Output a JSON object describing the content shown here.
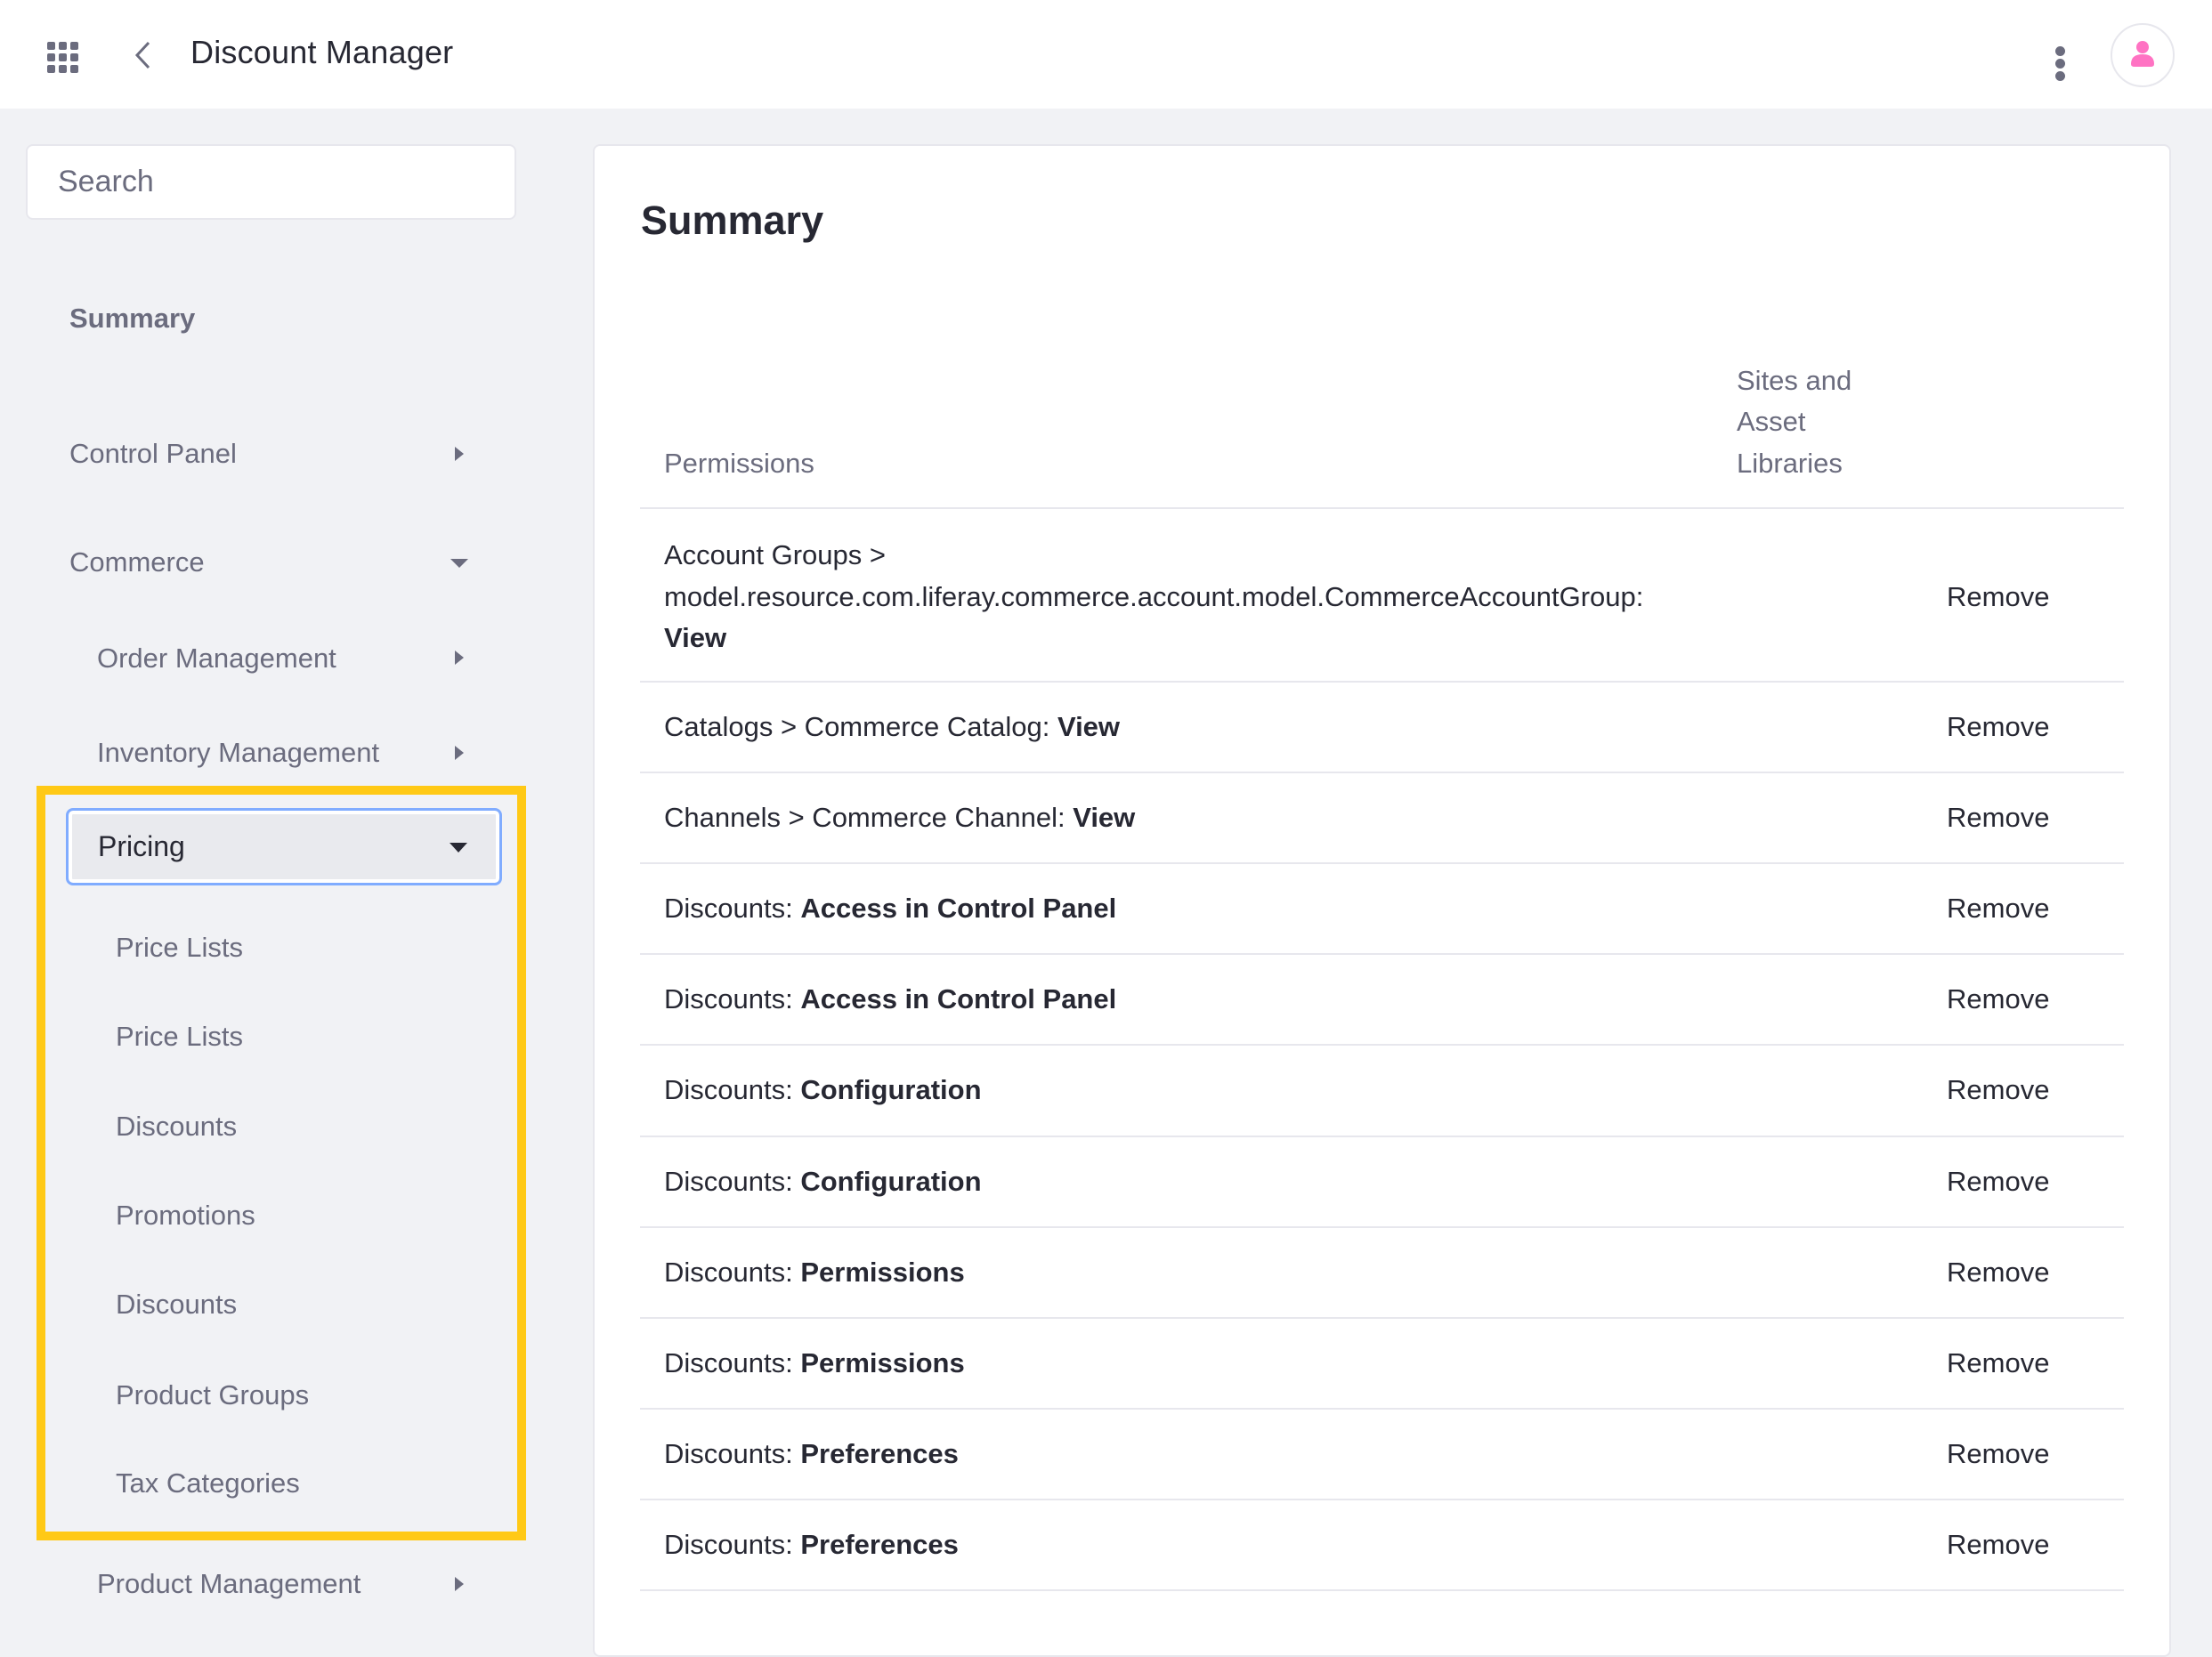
{
  "header": {
    "title": "Discount Manager",
    "apps_icon": "apps-grid-icon",
    "back_icon": "chevron-left-icon",
    "options_icon": "kebab-vertical-icon",
    "avatar_icon": "user-icon",
    "avatar_color": "#ff73c3"
  },
  "sidebar": {
    "search_placeholder": "Search",
    "summary_label": "Summary",
    "items": [
      {
        "label": "Control Panel",
        "state": "collapsed"
      },
      {
        "label": "Commerce",
        "state": "expanded"
      },
      {
        "label": "Order Management",
        "state": "collapsed"
      },
      {
        "label": "Inventory Management",
        "state": "collapsed"
      },
      {
        "label": "Pricing",
        "state": "expanded"
      },
      {
        "label": "Product Management",
        "state": "collapsed"
      }
    ],
    "pricing_children": [
      "Price Lists",
      "Price Lists",
      "Discounts",
      "Promotions",
      "Discounts",
      "Product Groups",
      "Tax Categories"
    ],
    "highlight_color": "#ffc916"
  },
  "main": {
    "title": "Summary",
    "columns": {
      "permissions": "Permissions",
      "sites_line1": "Sites and",
      "sites_line2": "Asset",
      "sites_line3": "Libraries"
    },
    "rows": [
      {
        "prefix_line1": "Account Groups >",
        "prefix_line2": "model.resource.com.liferay.commerce.account.model.CommerceAccountGroup:",
        "action": "View",
        "remove": "Remove"
      },
      {
        "prefix": "Catalogs > Commerce Catalog: ",
        "action": "View",
        "remove": "Remove"
      },
      {
        "prefix": "Channels > Commerce Channel: ",
        "action": "View",
        "remove": "Remove"
      },
      {
        "prefix": "Discounts: ",
        "action": "Access in Control Panel",
        "remove": "Remove"
      },
      {
        "prefix": "Discounts: ",
        "action": "Access in Control Panel",
        "remove": "Remove"
      },
      {
        "prefix": "Discounts: ",
        "action": "Configuration",
        "remove": "Remove"
      },
      {
        "prefix": "Discounts: ",
        "action": "Configuration",
        "remove": "Remove"
      },
      {
        "prefix": "Discounts: ",
        "action": "Permissions",
        "remove": "Remove"
      },
      {
        "prefix": "Discounts: ",
        "action": "Permissions",
        "remove": "Remove"
      },
      {
        "prefix": "Discounts: ",
        "action": "Preferences",
        "remove": "Remove"
      },
      {
        "prefix": "Discounts: ",
        "action": "Preferences",
        "remove": "Remove"
      }
    ]
  }
}
